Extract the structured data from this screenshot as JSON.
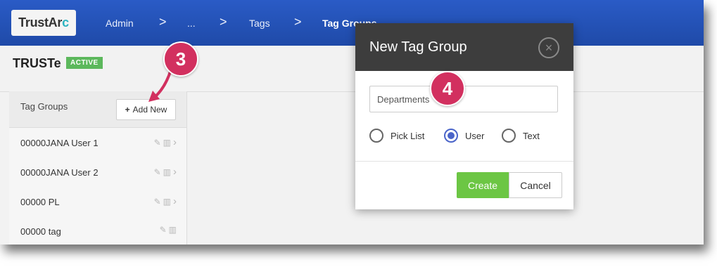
{
  "header": {
    "logo": {
      "main": "TrustAr",
      "accent": "c"
    },
    "breadcrumb": [
      "Admin",
      "...",
      "Tags",
      "Tag Groups"
    ],
    "separator": ">"
  },
  "org": {
    "name": "TRUSTe",
    "status": "ACTIVE"
  },
  "sidebar": {
    "title": "Tag Groups",
    "add_button": {
      "icon": "+",
      "label": "Add New"
    },
    "items": [
      {
        "label": "00000JANA User 1"
      },
      {
        "label": "00000JANA User 2"
      },
      {
        "label": "00000 PL"
      },
      {
        "label": "00000 tag"
      }
    ]
  },
  "annotations": {
    "step3": "3",
    "step4": "4"
  },
  "modal": {
    "title": "New Tag Group",
    "close_icon": "×",
    "input_value": "Departments",
    "radio_options": [
      {
        "label": "Pick List",
        "selected": false
      },
      {
        "label": "User",
        "selected": true
      },
      {
        "label": "Text",
        "selected": false
      }
    ],
    "create_label": "Create",
    "cancel_label": "Cancel"
  },
  "colors": {
    "topbar": "#2a5bc6",
    "active_badge": "#5cb85c",
    "annotation": "#d2305f",
    "create_button": "#6cc644",
    "radio_selected": "#4a64c9"
  }
}
